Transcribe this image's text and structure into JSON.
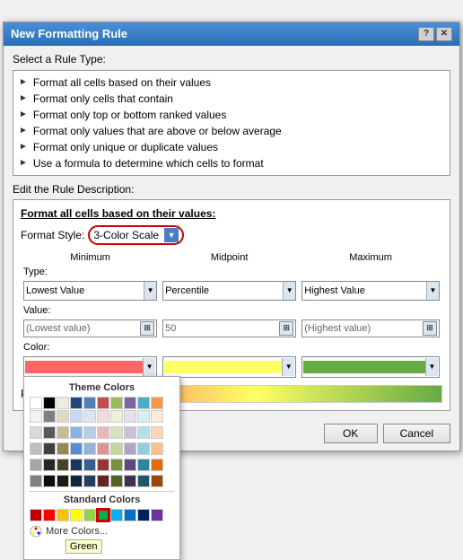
{
  "dialog": {
    "title": "New Formatting Rule",
    "help_btn": "?",
    "close_btn": "✕"
  },
  "rule_type_section": {
    "label": "Select a Rule Type:",
    "items": [
      "► Format all cells based on their values",
      "► Format only cells that contain",
      "► Format only top or bottom ranked values",
      "► Format only values that are above or below average",
      "► Format only unique or duplicate values",
      "► Use a formula to determine which cells to format"
    ]
  },
  "edit_section": {
    "label": "Edit the Rule Description:",
    "format_cells_title": "Format all cells based on their values:",
    "format_style_label": "Format Style:",
    "format_style_value": "3-Color Scale",
    "columns": {
      "minimum": "Minimum",
      "midpoint": "Midpoint",
      "maximum": "Maximum"
    },
    "type_row": {
      "label": "Type:",
      "minimum_type": "Lowest Value",
      "midpoint_type": "Percentile",
      "maximum_type": "Highest Value"
    },
    "value_row": {
      "label": "Value:",
      "minimum_value": "(Lowest value)",
      "midpoint_value": "50",
      "maximum_value": "(Highest value)"
    },
    "color_row": {
      "label": "Color:",
      "minimum_color": "#FF6666",
      "midpoint_color": "#FFFF66",
      "maximum_color": "#66AA44"
    },
    "preview_label": "Preview"
  },
  "color_popup": {
    "theme_title": "Theme Colors",
    "standard_title": "Standard Colors",
    "more_colors_label": "More Colors...",
    "tooltip": "Green",
    "theme_top_colors": [
      "#FFFFFF",
      "#000000",
      "#EEECE1",
      "#1F497D",
      "#4F81BD",
      "#C0504D",
      "#9BBB59",
      "#8064A2",
      "#4BACC6",
      "#F79646"
    ],
    "theme_shades": [
      [
        "#F2F2F2",
        "#808080",
        "#DDD9C3",
        "#C6D9F0",
        "#DBE5F1",
        "#F2DCDB",
        "#EBF1DD",
        "#E5E0EC",
        "#DBEEF3",
        "#FDEADA"
      ],
      [
        "#D9D9D9",
        "#595959",
        "#C4BD97",
        "#8DB3E2",
        "#B8CCE4",
        "#E6B9B8",
        "#D7E3BC",
        "#CCC1D9",
        "#B7DDE8",
        "#FBD5B5"
      ],
      [
        "#BFBFBF",
        "#404040",
        "#938953",
        "#548DD4",
        "#95B3D7",
        "#D99694",
        "#C3D69B",
        "#B2A2C7",
        "#92CDDC",
        "#FAC08F"
      ],
      [
        "#A6A6A6",
        "#262626",
        "#494429",
        "#17375E",
        "#366092",
        "#953734",
        "#76923C",
        "#5F497A",
        "#31849B",
        "#E36C09"
      ],
      [
        "#7F7F7F",
        "#0C0C0C",
        "#1D1B10",
        "#0F243E",
        "#244061",
        "#632523",
        "#4F6228",
        "#3F3151",
        "#205867",
        "#974806"
      ]
    ],
    "standard_colors": [
      "#C00000",
      "#FF0000",
      "#FFC000",
      "#FFFF00",
      "#92D050",
      "#00B050",
      "#00B0F0",
      "#0070C0",
      "#002060",
      "#7030A0"
    ]
  },
  "footer": {
    "ok_label": "OK",
    "cancel_label": "Cancel"
  }
}
